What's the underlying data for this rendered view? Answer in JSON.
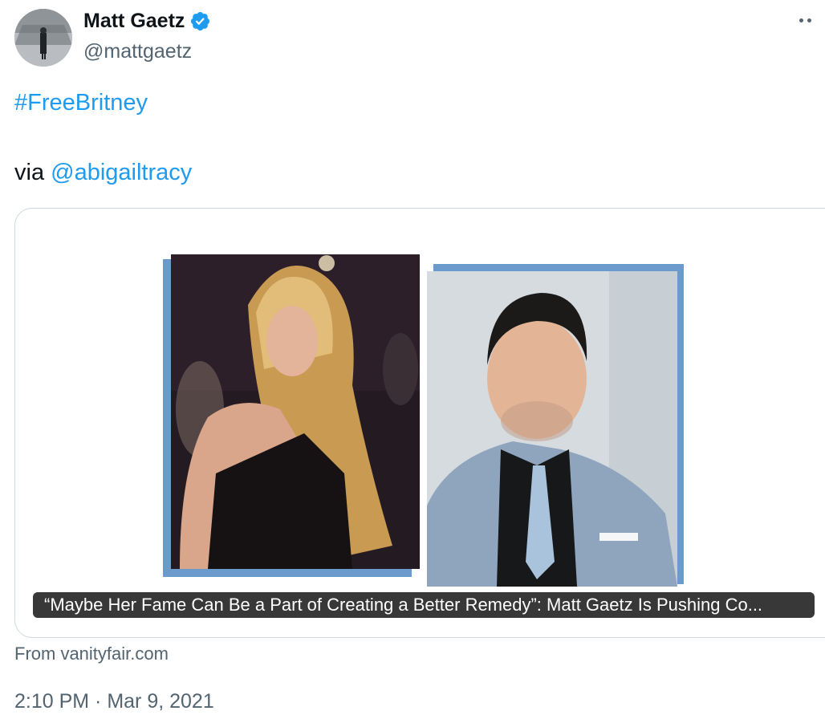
{
  "author": {
    "name": "Matt Gaetz",
    "handle": "@mattgaetz",
    "verified": true,
    "verified_color": "#1d9bf0"
  },
  "tweet": {
    "hashtag": "#FreeBritney",
    "via_prefix": "via ",
    "mention": "@abigailtracy"
  },
  "link_card": {
    "caption": "“Maybe Her Fame Can Be a Part of Creating a Better Remedy”: Matt Gaetz Is Pushing Co...",
    "source": "From vanityfair.com",
    "accent_color": "#6a9bcc"
  },
  "meta": {
    "timestamp": "2:10 PM · Mar 9, 2021"
  },
  "icons": [
    "avatar",
    "verified-badge-icon",
    "more-options-icon"
  ],
  "colors": {
    "link": "#1d9bf0",
    "secondary_text": "#536471",
    "border": "#cfd9de"
  }
}
